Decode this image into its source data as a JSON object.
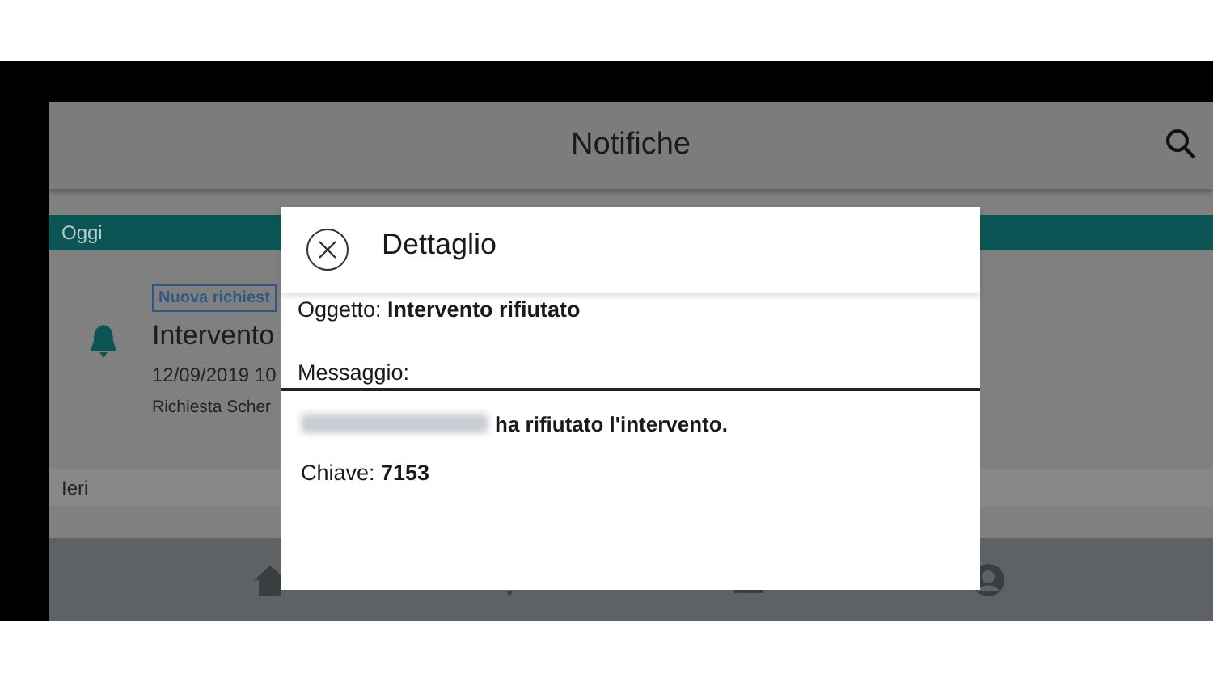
{
  "header": {
    "title": "Notifiche"
  },
  "sections": [
    {
      "label": "Oggi",
      "kind": "today",
      "notifications": [
        {
          "badge": "Nuova richiest",
          "title": "Intervento",
          "date": "12/09/2019 10",
          "text": "Richiesta Scher"
        }
      ]
    },
    {
      "label": "Ieri",
      "kind": "past"
    }
  ],
  "dialog": {
    "title": "Dettaglio",
    "subject_label": "Oggetto:",
    "subject": "Intervento rifiutato",
    "message_label": "Messaggio:",
    "message": {
      "sender_redacted": true,
      "text": "ha rifiutato l'intervento."
    },
    "key_label": "Chiave:",
    "key": "7153"
  }
}
